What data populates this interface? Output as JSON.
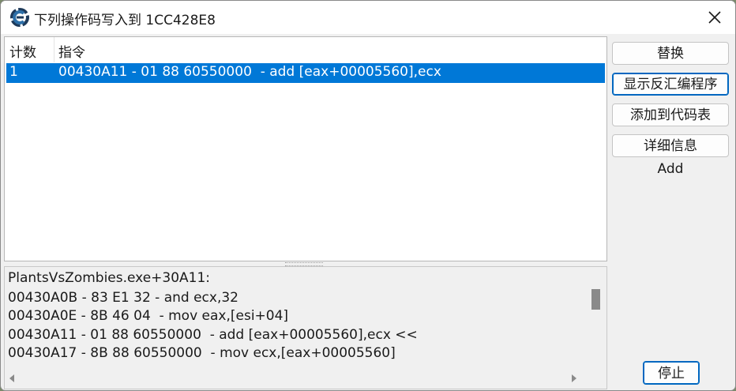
{
  "window": {
    "title": "下列操作码写入到 1CC428E8",
    "app_icon": "cheat-engine-icon",
    "close_icon": "close-icon"
  },
  "list": {
    "columns": [
      "计数",
      "指令"
    ],
    "rows": [
      {
        "count": "1",
        "instruction": "00430A11 - 01 88 60550000  - add [eax+00005560],ecx",
        "selected": true
      }
    ],
    "selection_color": "#0078d7"
  },
  "disasm": {
    "lines": [
      "PlantsVsZombies.exe+30A11:",
      "00430A0B - 83 E1 32 - and ecx,32",
      "00430A0E - 8B 46 04  - mov eax,[esi+04]",
      "00430A11 - 01 88 60550000  - add [eax+00005560],ecx <<",
      "00430A17 - 8B 88 60550000  - mov ecx,[eax+00005560]"
    ]
  },
  "buttons": {
    "replace": "替换",
    "show_disassembler": "显示反汇编程序",
    "add_to_codelist": "添加到代码表",
    "more_info": "详细信息",
    "stop": "停止"
  },
  "info_label": "Add"
}
